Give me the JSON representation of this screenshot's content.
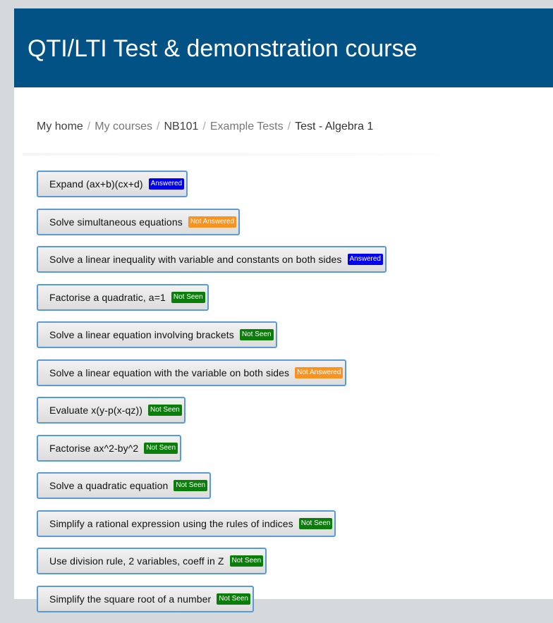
{
  "course": {
    "title": "QTI/LTI Test & demonstration course"
  },
  "breadcrumb": [
    {
      "label": "My home"
    },
    {
      "label": "My courses"
    },
    {
      "label": "NB101"
    },
    {
      "label": "Example Tests"
    },
    {
      "label": "Test - Algebra 1"
    }
  ],
  "breadcrumb_separator": "/",
  "status_colors": {
    "answered": "#0000ee",
    "not_answered": "#f7931e",
    "not_seen": "#0a7d0a"
  },
  "questions": [
    {
      "label": "Expand (ax+b)(cx+d)",
      "status": "Answered"
    },
    {
      "label": "Solve simultaneous equations",
      "status": "Not Answered"
    },
    {
      "label": "Solve a linear inequality with variable and constants on both sides",
      "status": "Answered"
    },
    {
      "label": "Factorise a quadratic, a=1",
      "status": "Not Seen"
    },
    {
      "label": "Solve a linear equation involving brackets",
      "status": "Not Seen"
    },
    {
      "label": "Solve a linear equation with the variable on both sides",
      "status": "Not Answered"
    },
    {
      "label": "Evaluate x(y-p(x-qz))",
      "status": "Not Seen"
    },
    {
      "label": "Factorise ax^2-by^2",
      "status": "Not Seen"
    },
    {
      "label": "Solve a quadratic equation",
      "status": "Not Seen"
    },
    {
      "label": "Simplify a rational expression using the rules of indices",
      "status": "Not Seen"
    },
    {
      "label": "Use division rule, 2 variables, coeff in Z",
      "status": "Not Seen"
    },
    {
      "label": "Simplify the square root of a number",
      "status": "Not Seen"
    }
  ]
}
